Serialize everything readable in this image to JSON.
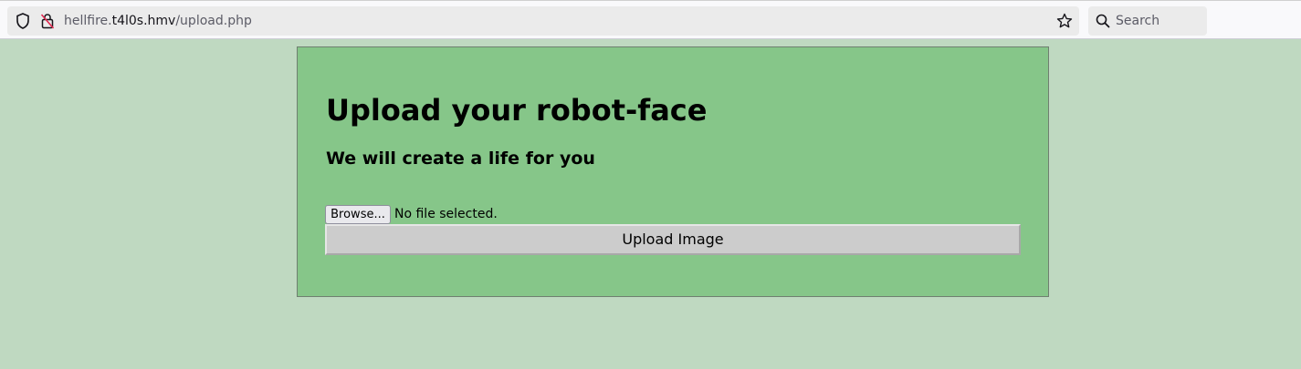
{
  "browser": {
    "url_prefix": "hellfire.",
    "url_domain": "t4l0s.hmv",
    "url_path": "/upload.php",
    "search_label": "Search",
    "icons": {
      "shield": "shield-icon",
      "insecure_lock": "insecure-lock-icon",
      "bookmark_star": "star-icon",
      "search": "search-icon"
    }
  },
  "page": {
    "heading": "Upload your robot-face",
    "subheading": "We will create a life for you",
    "file_input": {
      "browse_label": "Browse...",
      "status_text": "No file selected."
    },
    "submit_label": "Upload Image",
    "colors": {
      "page_background": "#bfd9c1",
      "panel_background": "#86c689",
      "button_background": "#cccccc"
    }
  }
}
